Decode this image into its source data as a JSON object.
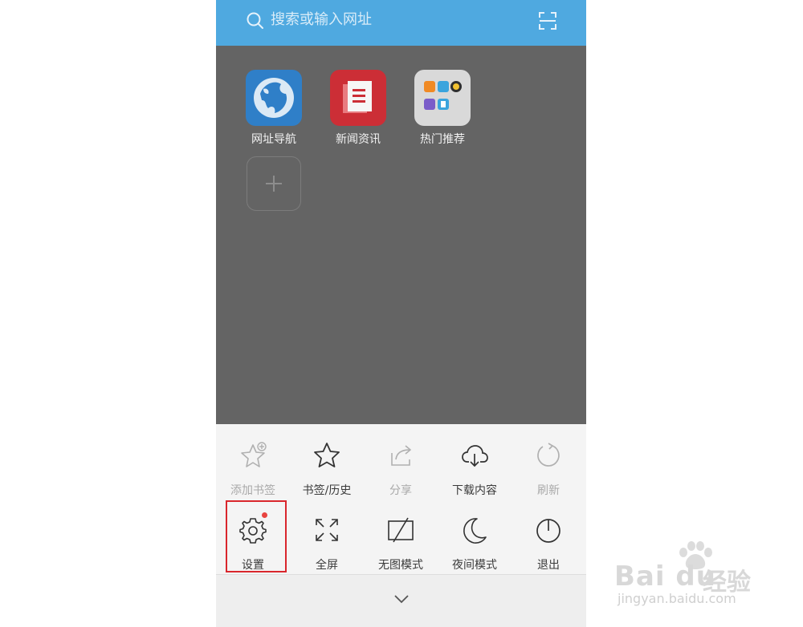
{
  "search_bar": {
    "placeholder": "搜索或输入网址",
    "accent": "#4fa9e0",
    "icon_left": "search-icon",
    "icon_right": "scan-icon"
  },
  "apps": [
    {
      "label": "网址导航",
      "icon": "globe-icon",
      "color": "#2f7fc8"
    },
    {
      "label": "新闻资讯",
      "icon": "news-icon",
      "color": "#cc2e36"
    },
    {
      "label": "热门推荐",
      "icon": "hot-recommend-icon",
      "color": "#dedede"
    }
  ],
  "add_button": {
    "icon": "plus-icon"
  },
  "menu": {
    "row1": [
      {
        "label": "添加书签",
        "icon": "add-bookmark-icon",
        "enabled": false
      },
      {
        "label": "书签/历史",
        "icon": "star-icon",
        "enabled": true
      },
      {
        "label": "分享",
        "icon": "share-icon",
        "enabled": false
      },
      {
        "label": "下载内容",
        "icon": "cloud-download-icon",
        "enabled": true
      },
      {
        "label": "刷新",
        "icon": "refresh-icon",
        "enabled": false
      }
    ],
    "row2": [
      {
        "label": "设置",
        "icon": "gear-icon",
        "enabled": true
      },
      {
        "label": "全屏",
        "icon": "fullscreen-icon",
        "enabled": true
      },
      {
        "label": "无图模式",
        "icon": "no-image-icon",
        "enabled": true
      },
      {
        "label": "夜间模式",
        "icon": "moon-icon",
        "enabled": true
      },
      {
        "label": "退出",
        "icon": "power-icon",
        "enabled": true
      }
    ],
    "highlight_color": "#d9262c"
  },
  "footer": {
    "icon": "chevron-down-icon"
  },
  "watermark": {
    "brand": "Bai du",
    "cn": "经验",
    "url": "jingyan.baidu.com"
  }
}
